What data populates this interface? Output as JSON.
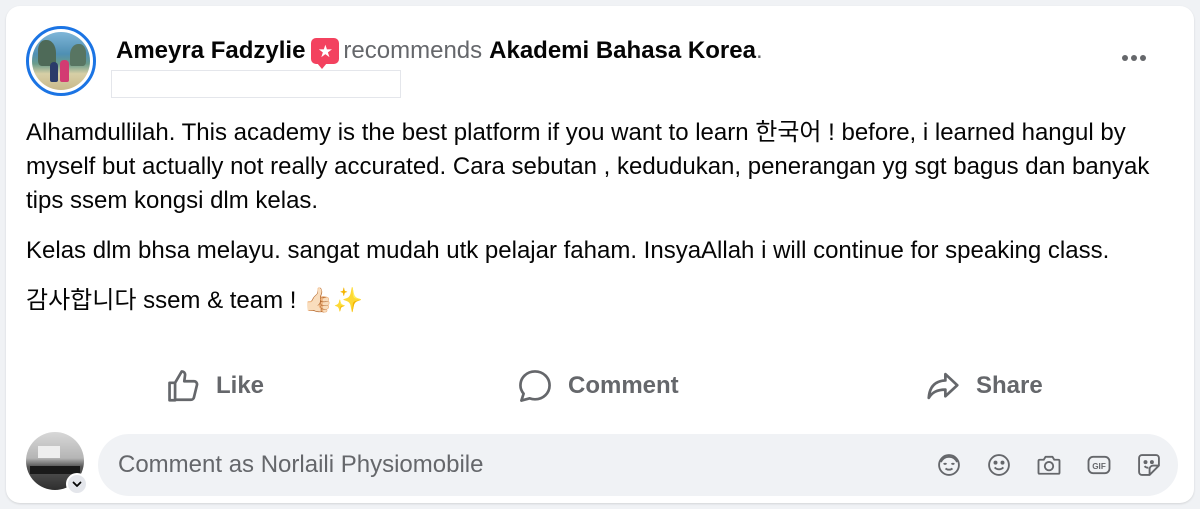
{
  "post": {
    "author": "Ameyra Fadzylie",
    "verb": "recommends",
    "page": "Akademi Bahasa Korea",
    "period": ".",
    "paragraphs": [
      "Alhamdullilah. This academy is the best platform if you want to learn 한국어 ! before, i learned hangul by myself but actually not really accurated. Cara sebutan , kedudukan, penerangan yg sgt bagus dan banyak tips ssem kongsi dlm kelas.",
      "Kelas dlm bhsa melayu. sangat mudah utk pelajar faham. InsyaAllah i will continue for speaking class.",
      "감사합니다 ssem & team ! 👍🏻✨"
    ]
  },
  "actions": {
    "like": "Like",
    "comment": "Comment",
    "share": "Share"
  },
  "comment_box": {
    "placeholder": "Comment as Norlaili Physiomobile"
  },
  "icons": {
    "recommend": "recommend-badge-icon",
    "more": "more-options-icon",
    "like": "thumbs-up-icon",
    "comment": "speech-bubble-icon",
    "share": "share-arrow-icon",
    "tools": [
      "avatar-sticker-icon",
      "emoji-icon",
      "camera-icon",
      "gif-icon",
      "sticker-icon"
    ]
  },
  "colors": {
    "accent": "#1b74e4",
    "recommend": "#f3425f",
    "secondary_text": "#65676b",
    "comment_bg": "#f0f2f5"
  }
}
